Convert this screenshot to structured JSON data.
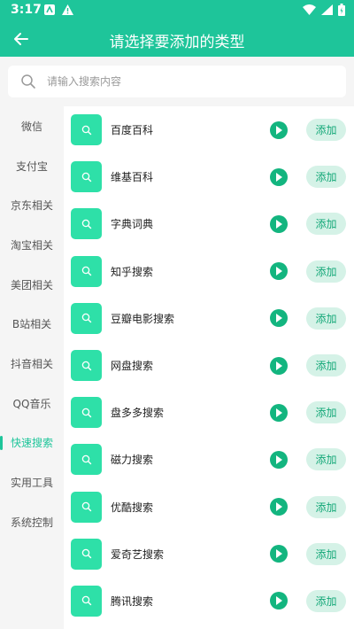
{
  "status": {
    "time": "3:17"
  },
  "header": {
    "title": "请选择要添加的类型"
  },
  "search": {
    "placeholder": "请输入搜索内容"
  },
  "sidebar": {
    "items": [
      {
        "label": "微信"
      },
      {
        "label": "支付宝"
      },
      {
        "label": "京东相关"
      },
      {
        "label": "淘宝相关"
      },
      {
        "label": "美团相关"
      },
      {
        "label": "B站相关"
      },
      {
        "label": "抖音相关"
      },
      {
        "label": "QQ音乐"
      },
      {
        "label": "快速搜索",
        "active": true
      },
      {
        "label": "实用工具"
      },
      {
        "label": "系统控制"
      }
    ]
  },
  "list": {
    "items": [
      {
        "label": "百度百科"
      },
      {
        "label": "维基百科"
      },
      {
        "label": "字典词典"
      },
      {
        "label": "知乎搜索"
      },
      {
        "label": "豆瓣电影搜索"
      },
      {
        "label": "网盘搜索"
      },
      {
        "label": "盘多多搜索"
      },
      {
        "label": "磁力搜索"
      },
      {
        "label": "优酷搜索"
      },
      {
        "label": "爱奇艺搜索"
      },
      {
        "label": "腾讯搜索"
      }
    ],
    "add_label": "添加"
  },
  "colors": {
    "accent": "#1ec59a",
    "thumb": "#2ee0a8",
    "play": "#13b57f",
    "add_bg": "#d5f2e7"
  }
}
